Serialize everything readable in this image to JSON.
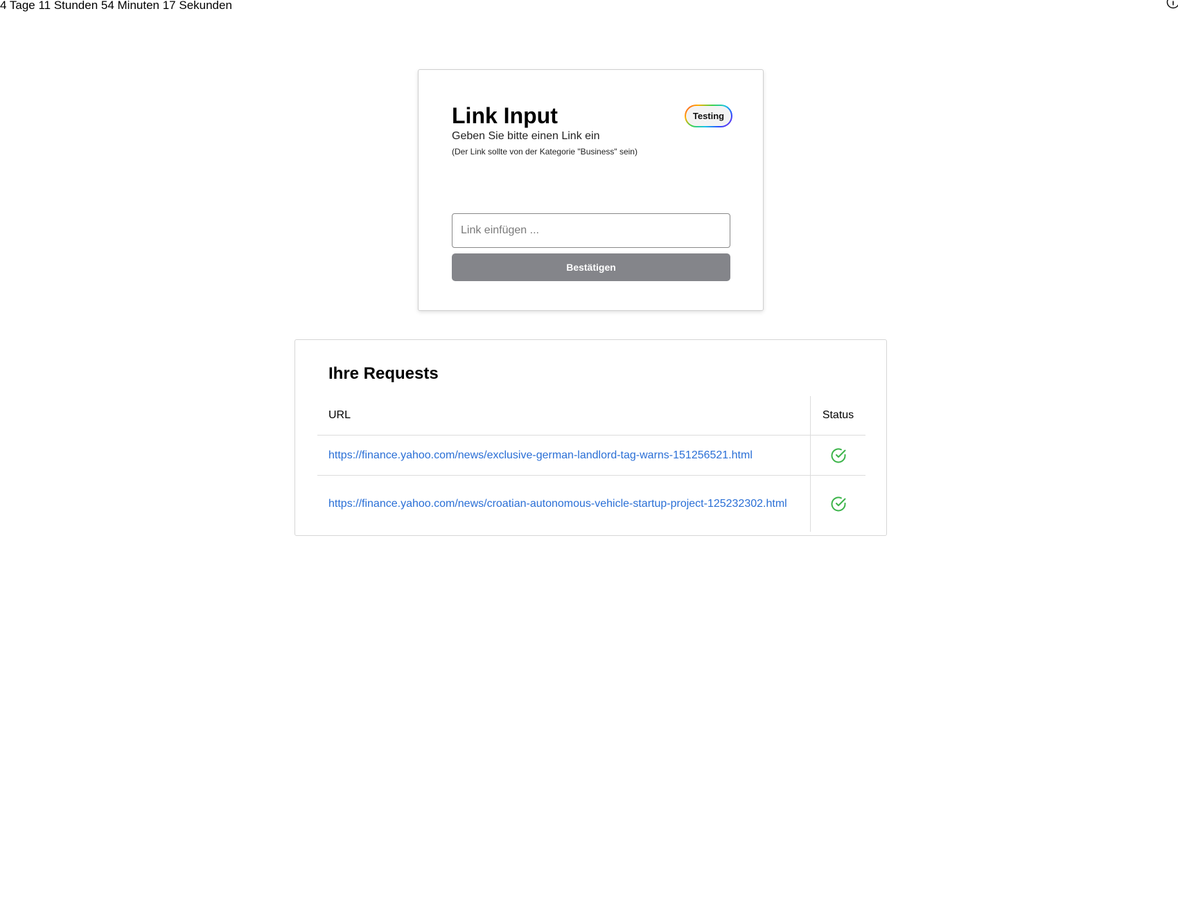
{
  "countdown": "4 Tage 11 Stunden 54 Minuten 17 Sekunden",
  "icons": {
    "info": "info-icon",
    "status_ok": "check-circle-icon"
  },
  "link_card": {
    "title": "Link Input",
    "subtitle": "Geben Sie bitte einen Link ein",
    "note": "(Der Link sollte von der Kategorie \"Business\" sein)",
    "badge": "Testing",
    "input_placeholder": "Link einfügen ...",
    "input_value": "",
    "submit_label": "Bestätigen"
  },
  "requests": {
    "title": "Ihre Requests",
    "columns": [
      "URL",
      "Status"
    ],
    "rows": [
      {
        "url": "https://finance.yahoo.com/news/exclusive-german-landlord-tag-warns-151256521.html",
        "status": "success"
      },
      {
        "url": "https://finance.yahoo.com/news/croatian-autonomous-vehicle-startup-project-125232302.html",
        "status": "success"
      }
    ]
  },
  "colors": {
    "link": "#2a6fd6",
    "button_bg": "#84858a",
    "status_ok": "#3cb44a"
  }
}
